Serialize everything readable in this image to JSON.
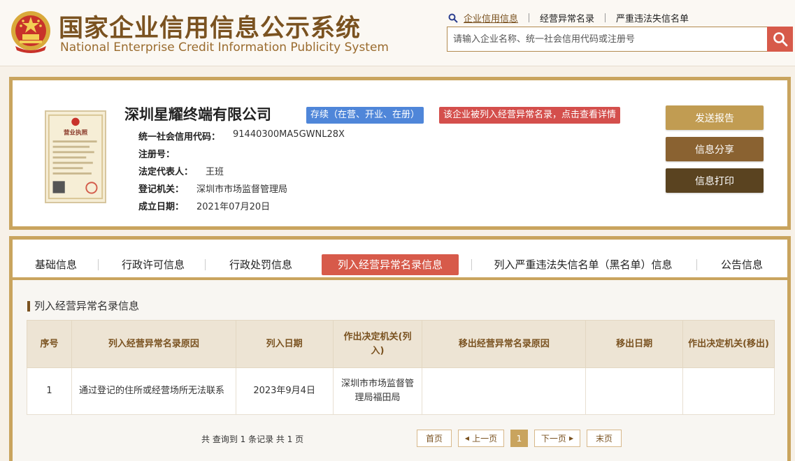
{
  "colors": {
    "brand": "#7a5220",
    "gold": "#c9a45e",
    "accent_red": "#d75a4a",
    "status_blue": "#4f86d9"
  },
  "header": {
    "title_cn": "国家企业信用信息公示系统",
    "title_en": "National Enterprise Credit Information Publicity System",
    "links": [
      "企业信用信息",
      "经营异常名录",
      "严重违法失信名单"
    ],
    "search_placeholder": "请输入企业名称、统一社会信用代码或注册号",
    "search_icon": "search-icon"
  },
  "company": {
    "name": "深圳星耀终端有限公司",
    "status_badge": "存续（在营、开业、在册）",
    "abnormal_badge": "该企业被列入经营异常名录，点击查看详情",
    "fields": [
      {
        "label": "统一社会信用代码：",
        "value": "91440300MA5GWNL28X"
      },
      {
        "label": "注册号：",
        "value": ""
      },
      {
        "label": "法定代表人：",
        "value": "王班"
      },
      {
        "label": "登记机关：",
        "value": "深圳市市场监督管理局"
      },
      {
        "label": "成立日期：",
        "value": "2021年07月20日"
      }
    ],
    "license_label": "营业执照",
    "actions": [
      "发送报告",
      "信息分享",
      "信息打印"
    ],
    "action_colors": [
      "#c19c52",
      "#8a6231",
      "#5a4320"
    ]
  },
  "tabs": [
    "基础信息",
    "行政许可信息",
    "行政处罚信息",
    "列入经营异常名录信息",
    "列入严重违法失信名单（黑名单）信息",
    "公告信息"
  ],
  "active_tab": 3,
  "section": {
    "title": "列入经营异常名录信息",
    "columns": [
      "序号",
      "列入经营异常名录原因",
      "列入日期",
      "作出决定机关(列入)",
      "移出经营异常名录原因",
      "移出日期",
      "作出决定机关(移出)"
    ],
    "rows": [
      [
        "1",
        "通过登记的住所或经营场所无法联系",
        "2023年9月4日",
        "深圳市市场监督管理局福田局",
        "",
        "",
        ""
      ]
    ]
  },
  "pagination": {
    "summary": "共 查询到 1 条记录 共 1 页",
    "first": "首页",
    "prev": "上一页",
    "current": "1",
    "next": "下一页",
    "last": "末页"
  }
}
